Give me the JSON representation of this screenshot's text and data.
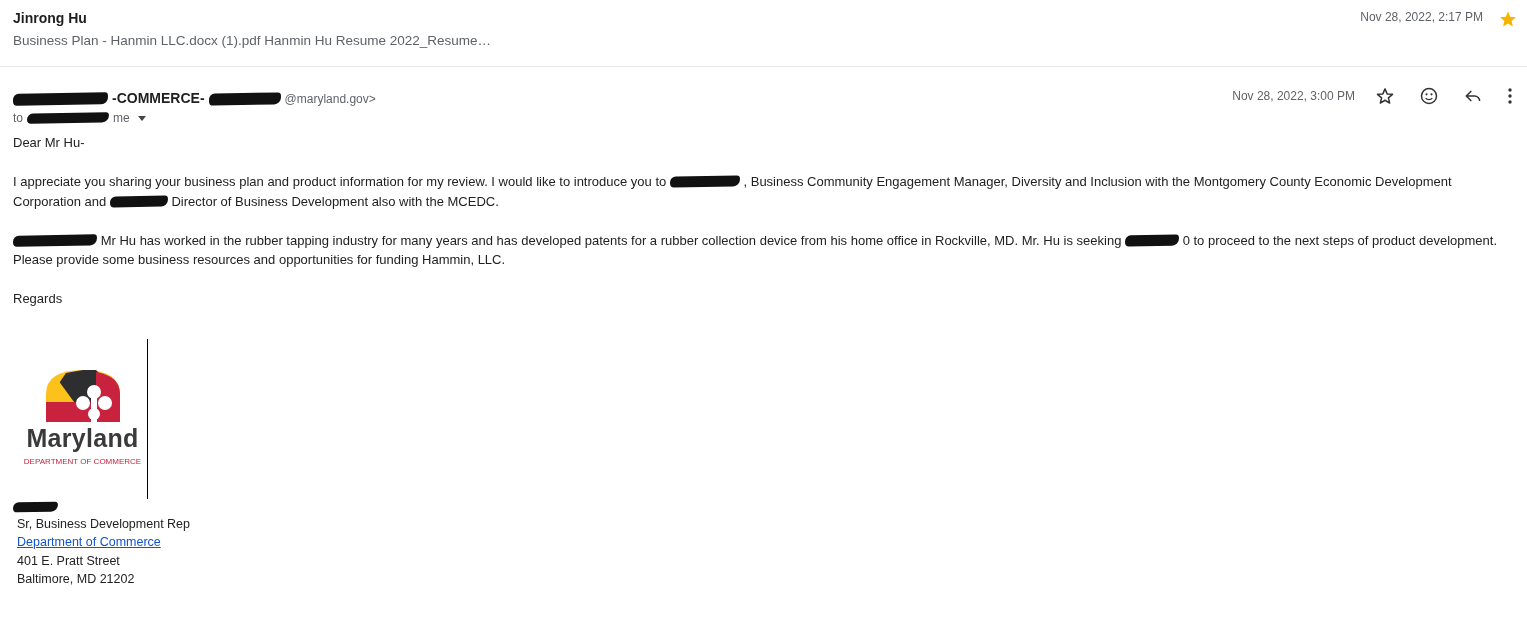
{
  "collapsed_message": {
    "sender": "Jinrong Hu",
    "snippet": "Business Plan - Hanmin LLC.docx (1).pdf Hanmin Hu Resume 2022_Resume…",
    "date": "Nov 28, 2022, 2:17 PM",
    "starred": true
  },
  "message": {
    "sender": [
      {
        "kind": "redacted"
      },
      {
        "kind": "text",
        "text": "-COMMERCE-"
      },
      {
        "kind": "redacted"
      },
      {
        "kind": "text",
        "text": "@maryland.gov>"
      }
    ],
    "recipients": [
      {
        "kind": "text",
        "text": "to"
      },
      {
        "kind": "redacted"
      },
      {
        "kind": "text",
        "text": "me"
      }
    ],
    "date": "Nov 28, 2022, 3:00 PM",
    "starred": false,
    "body": [
      [
        {
          "kind": "text",
          "text": "Dear Mr Hu-"
        }
      ],
      [
        {
          "kind": "text",
          "text": "I appreciate you sharing your business plan and product information for my review.  I would like to introduce you to"
        },
        {
          "kind": "redacted"
        },
        {
          "kind": "text",
          "text": ",  Business Community Engagement Manager, Diversity and Inclusion with the Montgomery County Economic Development Corporation and"
        },
        {
          "kind": "redacted"
        },
        {
          "kind": "text",
          "text": "Director of Business Development also with the MCEDC."
        }
      ],
      [
        {
          "kind": "redacted"
        },
        {
          "kind": "text",
          "text": "Mr Hu has worked in the rubber tapping industry for many years and has developed patents for a rubber collection device from his home office in Rockville, MD. Mr. Hu is seeking"
        },
        {
          "kind": "redacted"
        },
        {
          "kind": "text",
          "text": "0 to proceed to the next steps of product development. Please provide some business resources and opportunities for funding Hammin, LLC."
        }
      ],
      [
        {
          "kind": "text",
          "text": "Regards"
        }
      ]
    ],
    "signature": {
      "logo_name": "Maryland",
      "logo_subtitle": "DEPARTMENT OF COMMERCE",
      "lines": [
        {
          "kind": "redacted"
        },
        {
          "kind": "text",
          "text": "Sr, Business Development Rep"
        },
        {
          "kind": "link",
          "text": "Department of Commerce"
        },
        {
          "kind": "text",
          "text": "401 E. Pratt Street"
        },
        {
          "kind": "text",
          "text": "Baltimore, MD 21202"
        }
      ]
    }
  }
}
